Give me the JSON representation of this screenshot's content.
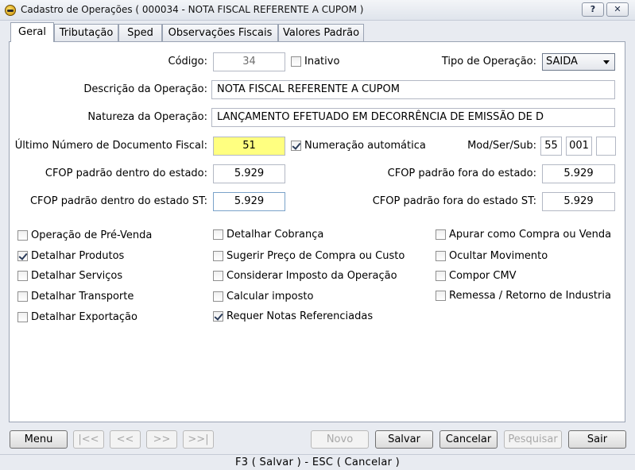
{
  "window": {
    "title": "Cadastro de Operações ( 000034 - NOTA FISCAL REFERENTE A CUPOM )",
    "help_label": "?",
    "close_label": "✕"
  },
  "tabs": [
    "Geral",
    "Tributação",
    "Sped",
    "Observações Fiscais",
    "Valores Padrão"
  ],
  "form": {
    "codigo_label": "Código:",
    "codigo_value": "34",
    "inativo_label": "Inativo",
    "tipo_label": "Tipo de Operação:",
    "tipo_value": "SAIDA",
    "descricao_label": "Descrição da Operação:",
    "descricao_value": "NOTA FISCAL REFERENTE A CUPOM",
    "natureza_label": "Natureza da Operação:",
    "natureza_value": "LANÇAMENTO EFETUADO EM DECORRÊNCIA DE EMISSÃO DE D",
    "ultimo_label": "Último Número de Documento Fiscal:",
    "ultimo_value": "51",
    "numeracao_label": "Numeração automática",
    "modsersub_label": "Mod/Ser/Sub:",
    "mod_value": "55",
    "ser_value": "001",
    "sub_value": "",
    "cfop_dentro_label": "CFOP padrão dentro do estado:",
    "cfop_dentro_value": "5.929",
    "cfop_fora_label": "CFOP padrão fora do estado:",
    "cfop_fora_value": "5.929",
    "cfop_dentro_st_label": "CFOP padrão dentro do estado ST:",
    "cfop_dentro_st_value": "5.929",
    "cfop_fora_st_label": "CFOP padrão fora do estado ST:",
    "cfop_fora_st_value": "5.929"
  },
  "checkboxes": {
    "col1": [
      {
        "label": "Operação de Pré-Venda",
        "checked": false
      },
      {
        "label": "Detalhar Produtos",
        "checked": true
      },
      {
        "label": "Detalhar Serviços",
        "checked": false
      },
      {
        "label": "Detalhar Transporte",
        "checked": false
      },
      {
        "label": "Detalhar Exportação",
        "checked": false
      }
    ],
    "col2": [
      {
        "label": "Detalhar Cobrança",
        "checked": false
      },
      {
        "label": "Sugerir Preço de Compra ou Custo",
        "checked": false
      },
      {
        "label": "Considerar Imposto da Operação",
        "checked": false
      },
      {
        "label": "Calcular imposto",
        "checked": false
      },
      {
        "label": "Requer Notas Referenciadas",
        "checked": true
      }
    ],
    "col3": [
      {
        "label": "Apurar como Compra ou Venda",
        "checked": false
      },
      {
        "label": "Ocultar Movimento",
        "checked": false
      },
      {
        "label": "Compor CMV",
        "checked": false
      },
      {
        "label": "Remessa / Retorno de Industria",
        "checked": false
      }
    ]
  },
  "buttons": {
    "menu": "Menu",
    "first": "|<<",
    "prev": "<<",
    "next": ">>",
    "last": ">>|",
    "novo": "Novo",
    "salvar": "Salvar",
    "cancelar": "Cancelar",
    "pesquisar": "Pesquisar",
    "sair": "Sair"
  },
  "status": "F3 ( Salvar )  -  ESC ( Cancelar )"
}
